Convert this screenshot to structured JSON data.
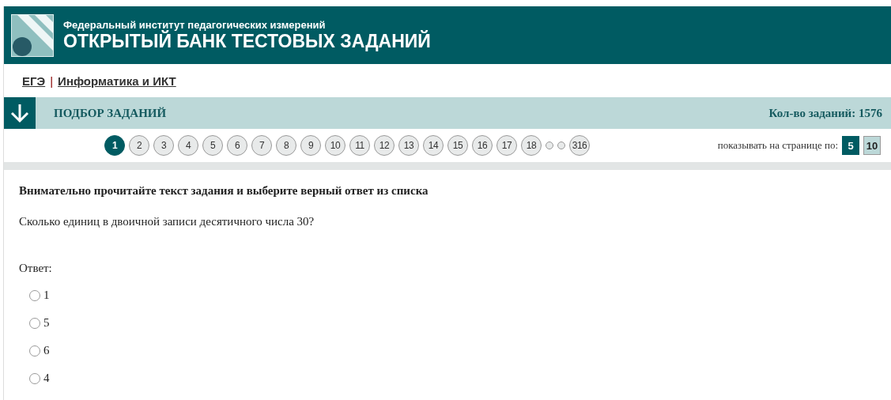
{
  "header": {
    "subtitle": "Федеральный институт педагогических измерений",
    "title": "ОТКРЫТЫЙ БАНК ТЕСТОВЫХ ЗАДАНИЙ"
  },
  "breadcrumbs": [
    {
      "label": "ЕГЭ"
    },
    {
      "label": "Информатика и ИКТ"
    }
  ],
  "breadcrumb_separator": "|",
  "filter_bar": {
    "title": "ПОДБОР ЗАДАНИЙ",
    "count": "Кол-во заданий: 1576"
  },
  "pagination": [
    {
      "kind": "page",
      "label": "1",
      "selected": true
    },
    {
      "kind": "page",
      "label": "2",
      "selected": false
    },
    {
      "kind": "page",
      "label": "3",
      "selected": false
    },
    {
      "kind": "page",
      "label": "4",
      "selected": false
    },
    {
      "kind": "page",
      "label": "5",
      "selected": false
    },
    {
      "kind": "page",
      "label": "6",
      "selected": false
    },
    {
      "kind": "page",
      "label": "7",
      "selected": false
    },
    {
      "kind": "page",
      "label": "8",
      "selected": false
    },
    {
      "kind": "page",
      "label": "9",
      "selected": false
    },
    {
      "kind": "page",
      "label": "10",
      "selected": false
    },
    {
      "kind": "page",
      "label": "11",
      "selected": false
    },
    {
      "kind": "page",
      "label": "12",
      "selected": false
    },
    {
      "kind": "page",
      "label": "13",
      "selected": false
    },
    {
      "kind": "page",
      "label": "14",
      "selected": false
    },
    {
      "kind": "page",
      "label": "15",
      "selected": false
    },
    {
      "kind": "page",
      "label": "16",
      "selected": false
    },
    {
      "kind": "page",
      "label": "17",
      "selected": false
    },
    {
      "kind": "page",
      "label": "18",
      "selected": false
    },
    {
      "kind": "gap"
    },
    {
      "kind": "page",
      "label": "316",
      "selected": false
    }
  ],
  "per_page": {
    "label": "показывать на странице по:",
    "options": [
      {
        "label": "5",
        "selected": true
      },
      {
        "label": "10",
        "selected": false
      }
    ]
  },
  "task": {
    "instruction": "Внимательно прочитайте текст задания и выберите верный ответ из списка",
    "question": "Сколько единиц в двоичной записи десятичного числа 30?",
    "answer_label": "Ответ:",
    "options": [
      {
        "label": "1",
        "checked": false
      },
      {
        "label": "5",
        "checked": false
      },
      {
        "label": "6",
        "checked": false
      },
      {
        "label": "4",
        "checked": false
      }
    ]
  }
}
